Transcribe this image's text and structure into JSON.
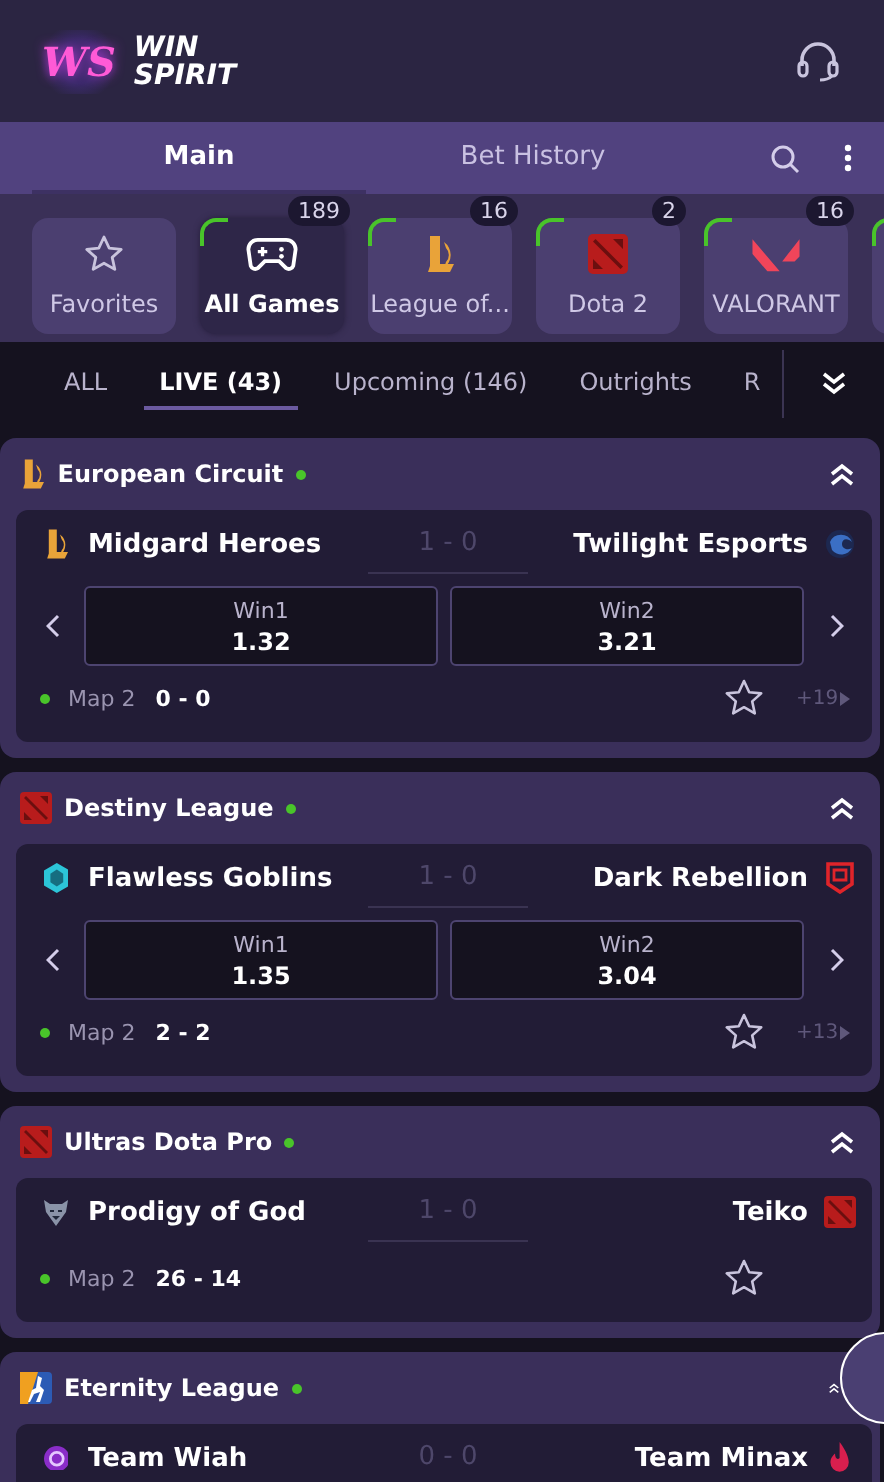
{
  "header": {
    "logo_mark": "WS",
    "logo_lines": [
      "WIN",
      "SPIRIT"
    ]
  },
  "nav": {
    "tabs": [
      {
        "label": "Main",
        "selected": true
      },
      {
        "label": "Bet History",
        "selected": false
      }
    ]
  },
  "categories": [
    {
      "label": "Favorites",
      "kind": "star",
      "selected": false,
      "live": false
    },
    {
      "label": "All Games",
      "kind": "gamepad",
      "count": "189",
      "selected": true,
      "live": true
    },
    {
      "label": "League of...",
      "kind": "lol",
      "count": "16",
      "selected": false,
      "live": true
    },
    {
      "label": "Dota 2",
      "kind": "dota",
      "count": "2",
      "selected": false,
      "live": true
    },
    {
      "label": "VALORANT",
      "kind": "valorant",
      "count": "16",
      "selected": false,
      "live": true
    },
    {
      "kind": "blank",
      "selected": false,
      "live": true
    }
  ],
  "filters": [
    {
      "label": "ALL",
      "selected": false
    },
    {
      "label": "LIVE (43)",
      "selected": true
    },
    {
      "label": "Upcoming (146)",
      "selected": false
    },
    {
      "label": "Outrights",
      "selected": false
    },
    {
      "label": "R",
      "selected": false
    }
  ],
  "leagues": [
    {
      "name": "European Circuit",
      "kind": "lol",
      "live": true,
      "expanded": true,
      "matches": [
        {
          "team1": {
            "name": "Midgard Heroes",
            "kind": "lol"
          },
          "score": "1 - 0",
          "team2": {
            "name": "Twilight Esports",
            "kind": "orb"
          },
          "odds": [
            {
              "label": "Win1",
              "value": "1.32"
            },
            {
              "label": "Win2",
              "value": "3.21"
            }
          ],
          "map": "Map 2",
          "map_score": "0 - 0",
          "favorite": false,
          "more": "+19"
        }
      ]
    },
    {
      "name": "Destiny League",
      "kind": "dota",
      "live": true,
      "expanded": true,
      "matches": [
        {
          "team1": {
            "name": "Flawless Goblins",
            "kind": "hex"
          },
          "score": "1 - 0",
          "team2": {
            "name": "Dark Rebellion",
            "kind": "shield"
          },
          "odds": [
            {
              "label": "Win1",
              "value": "1.35"
            },
            {
              "label": "Win2",
              "value": "3.04"
            }
          ],
          "map": "Map 2",
          "map_score": "2 - 2",
          "favorite": false,
          "more": "+13"
        }
      ]
    },
    {
      "name": "Ultras Dota Pro",
      "kind": "dota",
      "live": true,
      "expanded": true,
      "matches": [
        {
          "team1": {
            "name": "Prodigy of God",
            "kind": "bear"
          },
          "score": "1 - 0",
          "team2": {
            "name": "Teiko",
            "kind": "dota"
          },
          "map": "Map 2",
          "map_score": "26 - 14",
          "favorite": false
        }
      ]
    },
    {
      "name": "Eternity League",
      "kind": "cs",
      "live": true,
      "expanded": true,
      "matches": [
        {
          "team1": {
            "name": "Team Wiah",
            "kind": "purple"
          },
          "score": "0 - 0",
          "team2": {
            "name": "Team Minax",
            "kind": "flame"
          }
        }
      ]
    }
  ]
}
